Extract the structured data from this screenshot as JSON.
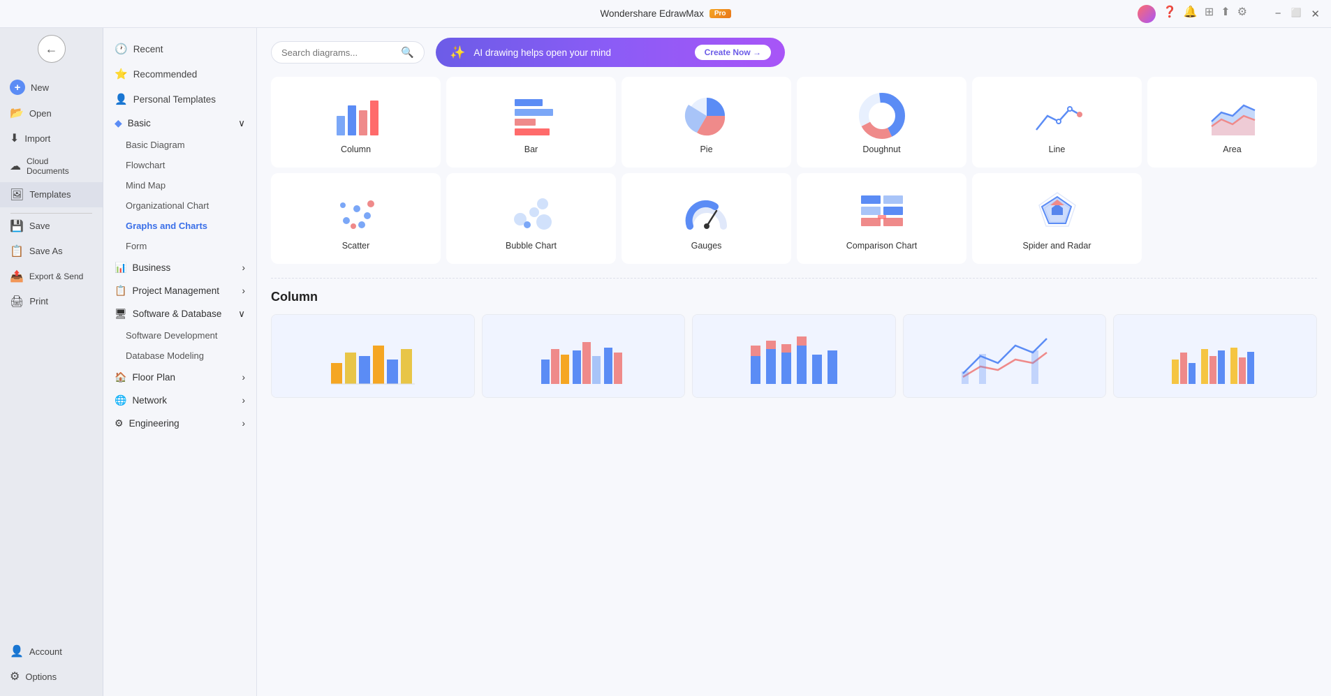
{
  "app": {
    "title": "Wondershare EdrawMax",
    "pro_badge": "Pro"
  },
  "titlebar": {
    "minimize": "−",
    "restore": "⬜",
    "close": "✕"
  },
  "sidebar_narrow": {
    "new_label": "New",
    "open_label": "Open",
    "import_label": "Import",
    "cloud_label": "Cloud Documents",
    "templates_label": "Templates",
    "save_label": "Save",
    "save_as_label": "Save As",
    "export_label": "Export & Send",
    "print_label": "Print",
    "account_label": "Account",
    "options_label": "Options"
  },
  "sidebar_wide": {
    "recent_label": "Recent",
    "recommended_label": "Recommended",
    "personal_templates_label": "Personal Templates",
    "sections": [
      {
        "id": "basic",
        "label": "Basic",
        "expanded": true,
        "items": [
          "Basic Diagram",
          "Flowchart",
          "Mind Map",
          "Organizational Chart",
          "Graphs and Charts",
          "Form"
        ]
      },
      {
        "id": "business",
        "label": "Business",
        "expanded": false,
        "items": []
      },
      {
        "id": "project-management",
        "label": "Project Management",
        "expanded": false,
        "items": []
      },
      {
        "id": "software-database",
        "label": "Software & Database",
        "expanded": true,
        "items": [
          "Software Development",
          "Database Modeling"
        ]
      },
      {
        "id": "floor-plan",
        "label": "Floor Plan",
        "expanded": false,
        "items": []
      },
      {
        "id": "network",
        "label": "Network",
        "expanded": false,
        "items": []
      },
      {
        "id": "engineering",
        "label": "Engineering",
        "expanded": false,
        "items": []
      }
    ]
  },
  "search": {
    "placeholder": "Search diagrams..."
  },
  "ai_banner": {
    "text": "AI drawing helps open your mind",
    "cta": "Create Now →"
  },
  "chart_types": [
    {
      "id": "column",
      "label": "Column"
    },
    {
      "id": "bar",
      "label": "Bar"
    },
    {
      "id": "pie",
      "label": "Pie"
    },
    {
      "id": "doughnut",
      "label": "Doughnut"
    },
    {
      "id": "line",
      "label": "Line"
    },
    {
      "id": "area",
      "label": "Area"
    },
    {
      "id": "scatter",
      "label": "Scatter"
    },
    {
      "id": "bubble",
      "label": "Bubble Chart"
    },
    {
      "id": "gauges",
      "label": "Gauges"
    },
    {
      "id": "comparison",
      "label": "Comparison Chart"
    },
    {
      "id": "spider",
      "label": "Spider and Radar"
    }
  ],
  "section_column": {
    "title": "Column"
  }
}
